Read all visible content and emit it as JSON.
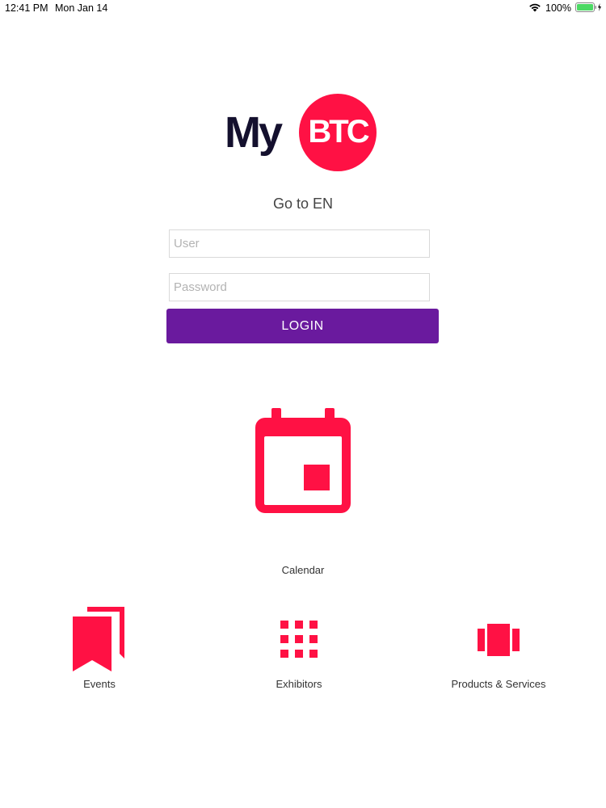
{
  "status_bar": {
    "time": "12:41 PM",
    "date": "Mon Jan 14",
    "battery_percent": "100%",
    "wifi_icon": "wifi-icon",
    "battery_icon": "battery-charging-icon"
  },
  "logo": {
    "text_my": "My",
    "text_btc": "BTC",
    "circle_color": "#ff1144",
    "text_color": "#14102e"
  },
  "language_link": "Go to EN",
  "login_form": {
    "user_placeholder": "User",
    "user_value": "",
    "password_placeholder": "Password",
    "password_value": "",
    "login_label": "LOGIN",
    "button_color": "#6a1a9e"
  },
  "calendar": {
    "label": "Calendar",
    "icon": "calendar-icon"
  },
  "nav_items": [
    {
      "label": "Events",
      "icon": "bookmarks-icon"
    },
    {
      "label": "Exhibitors",
      "icon": "grid-icon"
    },
    {
      "label": "Products & Services",
      "icon": "carousel-icon"
    }
  ],
  "colors": {
    "accent": "#ff1144",
    "primary_button": "#6a1a9e"
  }
}
